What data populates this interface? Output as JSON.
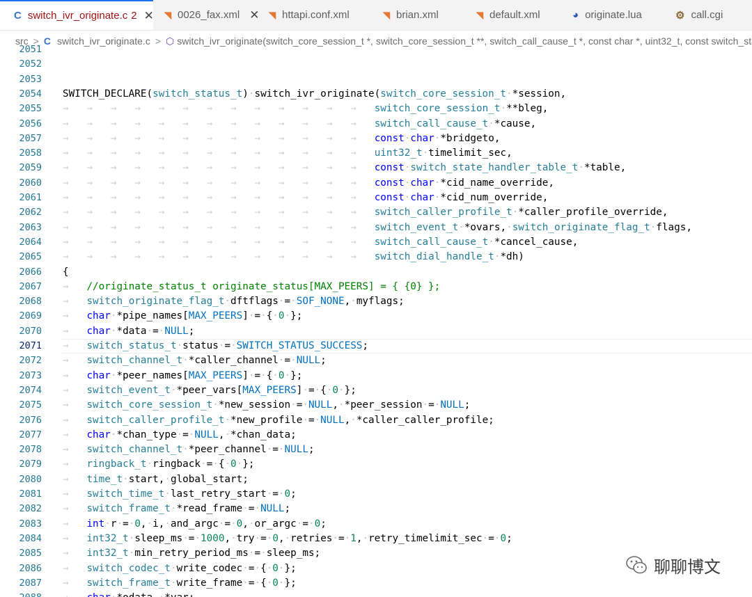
{
  "tabs": [
    {
      "label": "switch_ivr_originate.c",
      "icon": "c-file-icon",
      "badge": "2",
      "active": true
    },
    {
      "label": "0026_fax.xml",
      "icon": "rss-icon"
    },
    {
      "label": "httapi.conf.xml",
      "icon": "rss-icon"
    },
    {
      "label": "brian.xml",
      "icon": "rss-icon"
    },
    {
      "label": "default.xml",
      "icon": "rss-icon"
    },
    {
      "label": "originate.lua",
      "icon": "lua-icon"
    },
    {
      "label": "call.cgi",
      "icon": "cgi-icon"
    }
  ],
  "breadcrumb": {
    "folder": "src",
    "file": "switch_ivr_originate.c",
    "symbol": "switch_ivr_originate(switch_core_session_t *, switch_core_session_t **, switch_call_cause_t *, const char *, uint32_t, const switch_sta"
  },
  "editor": {
    "current_line": "2071",
    "lines": [
      {
        "n": "2051",
        "code": ""
      },
      {
        "n": "2052",
        "code": ""
      },
      {
        "n": "2053",
        "code": ""
      },
      {
        "n": "2054",
        "code": "SWITCH_DECLARE(switch_status_t) switch_ivr_originate(switch_core_session_t *session,"
      },
      {
        "n": "2055",
        "code": "                                                    switch_core_session_t **bleg,"
      },
      {
        "n": "2056",
        "code": "                                                    switch_call_cause_t *cause,"
      },
      {
        "n": "2057",
        "code": "                                                    const char *bridgeto,"
      },
      {
        "n": "2058",
        "code": "                                                    uint32_t timelimit_sec,"
      },
      {
        "n": "2059",
        "code": "                                                    const switch_state_handler_table_t *table,"
      },
      {
        "n": "2060",
        "code": "                                                    const char *cid_name_override,"
      },
      {
        "n": "2061",
        "code": "                                                    const char *cid_num_override,"
      },
      {
        "n": "2062",
        "code": "                                                    switch_caller_profile_t *caller_profile_override,"
      },
      {
        "n": "2063",
        "code": "                                                    switch_event_t *ovars, switch_originate_flag_t flags,"
      },
      {
        "n": "2064",
        "code": "                                                    switch_call_cause_t *cancel_cause,"
      },
      {
        "n": "2065",
        "code": "                                                    switch_dial_handle_t *dh)"
      },
      {
        "n": "2066",
        "code": "{"
      },
      {
        "n": "2067",
        "code": "    //originate_status_t originate_status[MAX_PEERS] = { {0} };"
      },
      {
        "n": "2068",
        "code": "    switch_originate_flag_t dftflags = SOF_NONE, myflags;"
      },
      {
        "n": "2069",
        "code": "    char *pipe_names[MAX_PEERS] = { 0 };"
      },
      {
        "n": "2070",
        "code": "    char *data = NULL;"
      },
      {
        "n": "2071",
        "code": "    switch_status_t status = SWITCH_STATUS_SUCCESS;"
      },
      {
        "n": "2072",
        "code": "    switch_channel_t *caller_channel = NULL;"
      },
      {
        "n": "2073",
        "code": "    char *peer_names[MAX_PEERS] = { 0 };"
      },
      {
        "n": "2074",
        "code": "    switch_event_t *peer_vars[MAX_PEERS] = { 0 };"
      },
      {
        "n": "2075",
        "code": "    switch_core_session_t *new_session = NULL, *peer_session = NULL;"
      },
      {
        "n": "2076",
        "code": "    switch_caller_profile_t *new_profile = NULL, *caller_caller_profile;"
      },
      {
        "n": "2077",
        "code": "    char *chan_type = NULL, *chan_data;"
      },
      {
        "n": "2078",
        "code": "    switch_channel_t *peer_channel = NULL;"
      },
      {
        "n": "2079",
        "code": "    ringback_t ringback = { 0 };"
      },
      {
        "n": "2080",
        "code": "    time_t start, global_start;"
      },
      {
        "n": "2081",
        "code": "    switch_time_t last_retry_start = 0;"
      },
      {
        "n": "2082",
        "code": "    switch_frame_t *read_frame = NULL;"
      },
      {
        "n": "2083",
        "code": "    int r = 0, i, and_argc = 0, or_argc = 0;"
      },
      {
        "n": "2084",
        "code": "    int32_t sleep_ms = 1000, try = 0, retries = 1, retry_timelimit_sec = 0;"
      },
      {
        "n": "2085",
        "code": "    int32_t min_retry_period_ms = sleep_ms;"
      },
      {
        "n": "2086",
        "code": "    switch_codec_t write_codec = { 0 };"
      },
      {
        "n": "2087",
        "code": "    switch_frame_t write_frame = { 0 };"
      },
      {
        "n": "2088",
        "code": "    char *odata, *var;"
      }
    ]
  },
  "watermark": {
    "text": "聊聊博文",
    "icon": "wechat-icon"
  }
}
